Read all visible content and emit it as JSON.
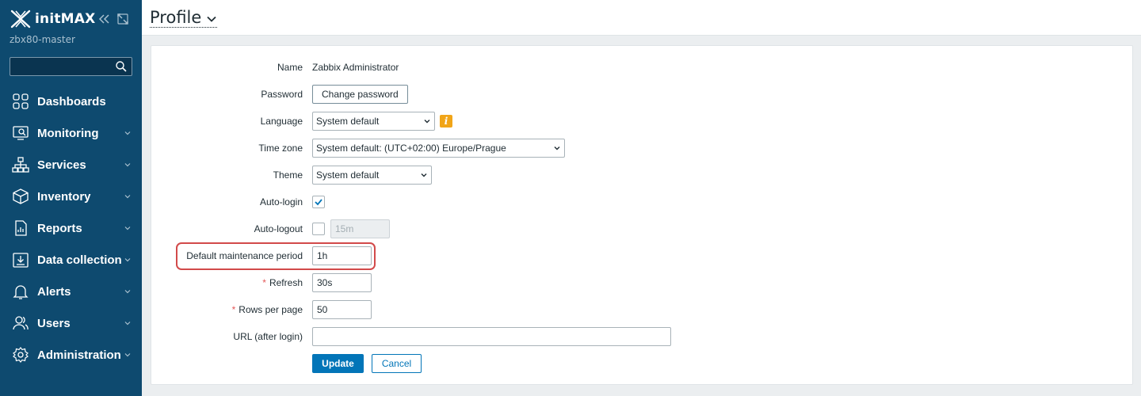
{
  "sidebar": {
    "brand": "initMAX",
    "server_name": "zbx80-master",
    "search": {
      "value": "",
      "placeholder": ""
    },
    "menu": [
      {
        "label": "Dashboards",
        "icon": "dashboards-icon",
        "has_submenu": false
      },
      {
        "label": "Monitoring",
        "icon": "monitoring-icon",
        "has_submenu": true
      },
      {
        "label": "Services",
        "icon": "services-icon",
        "has_submenu": true
      },
      {
        "label": "Inventory",
        "icon": "inventory-icon",
        "has_submenu": true
      },
      {
        "label": "Reports",
        "icon": "reports-icon",
        "has_submenu": true
      },
      {
        "label": "Data collection",
        "icon": "data-collection-icon",
        "has_submenu": true
      },
      {
        "label": "Alerts",
        "icon": "alerts-icon",
        "has_submenu": true
      },
      {
        "label": "Users",
        "icon": "users-icon",
        "has_submenu": true
      },
      {
        "label": "Administration",
        "icon": "administration-icon",
        "has_submenu": true
      }
    ]
  },
  "header": {
    "title": "Profile"
  },
  "form": {
    "name": {
      "label": "Name",
      "value": "Zabbix Administrator"
    },
    "password": {
      "label": "Password",
      "button": "Change password"
    },
    "language": {
      "label": "Language",
      "value": "System default"
    },
    "timezone": {
      "label": "Time zone",
      "value": "System default: (UTC+02:00) Europe/Prague"
    },
    "theme": {
      "label": "Theme",
      "value": "System default"
    },
    "autologin": {
      "label": "Auto-login",
      "checked": true
    },
    "autologout": {
      "label": "Auto-logout",
      "checked": false,
      "value": "15m"
    },
    "maintenance": {
      "label": "Default maintenance period",
      "value": "1h"
    },
    "refresh": {
      "label": "Refresh",
      "required_mark": "*",
      "value": "30s"
    },
    "rows": {
      "label": "Rows per page",
      "required_mark": "*",
      "value": "50"
    },
    "url": {
      "label": "URL (after login)",
      "value": ""
    },
    "update_button": "Update",
    "cancel_button": "Cancel"
  },
  "colors": {
    "sidebar_bg": "#0e4a6f",
    "primary": "#0275b8",
    "warning_badge": "#f1a518",
    "highlight": "#d24a4a"
  }
}
